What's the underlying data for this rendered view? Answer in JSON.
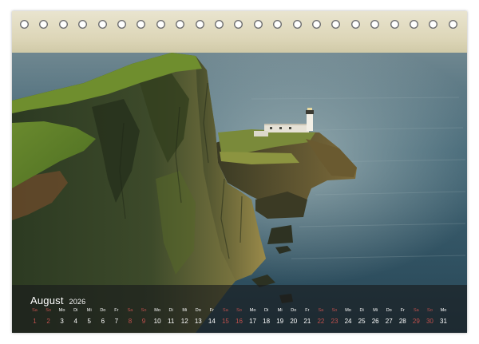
{
  "calendar": {
    "month": "August",
    "year": "2026",
    "weekend_color": "#c0504d",
    "days": [
      {
        "wd": "Sa",
        "d": "1",
        "we": true
      },
      {
        "wd": "So",
        "d": "2",
        "we": true
      },
      {
        "wd": "Mo",
        "d": "3",
        "we": false
      },
      {
        "wd": "Di",
        "d": "4",
        "we": false
      },
      {
        "wd": "Mi",
        "d": "5",
        "we": false
      },
      {
        "wd": "Do",
        "d": "6",
        "we": false
      },
      {
        "wd": "Fr",
        "d": "7",
        "we": false
      },
      {
        "wd": "Sa",
        "d": "8",
        "we": true
      },
      {
        "wd": "So",
        "d": "9",
        "we": true
      },
      {
        "wd": "Mo",
        "d": "10",
        "we": false
      },
      {
        "wd": "Di",
        "d": "11",
        "we": false
      },
      {
        "wd": "Mi",
        "d": "12",
        "we": false
      },
      {
        "wd": "Do",
        "d": "13",
        "we": false
      },
      {
        "wd": "Fr",
        "d": "14",
        "we": false
      },
      {
        "wd": "Sa",
        "d": "15",
        "we": true
      },
      {
        "wd": "So",
        "d": "16",
        "we": true
      },
      {
        "wd": "Mo",
        "d": "17",
        "we": false
      },
      {
        "wd": "Di",
        "d": "18",
        "we": false
      },
      {
        "wd": "Mi",
        "d": "19",
        "we": false
      },
      {
        "wd": "Do",
        "d": "20",
        "we": false
      },
      {
        "wd": "Fr",
        "d": "21",
        "we": false
      },
      {
        "wd": "Sa",
        "d": "22",
        "we": true
      },
      {
        "wd": "So",
        "d": "23",
        "we": true
      },
      {
        "wd": "Mo",
        "d": "24",
        "we": false
      },
      {
        "wd": "Di",
        "d": "25",
        "we": false
      },
      {
        "wd": "Mi",
        "d": "26",
        "we": false
      },
      {
        "wd": "Do",
        "d": "27",
        "we": false
      },
      {
        "wd": "Fr",
        "d": "28",
        "we": false
      },
      {
        "wd": "Sa",
        "d": "29",
        "we": true
      },
      {
        "wd": "So",
        "d": "30",
        "we": true
      },
      {
        "wd": "Mo",
        "d": "31",
        "we": false
      }
    ]
  },
  "photo": {
    "subject_icon": "lighthouse-icon"
  }
}
